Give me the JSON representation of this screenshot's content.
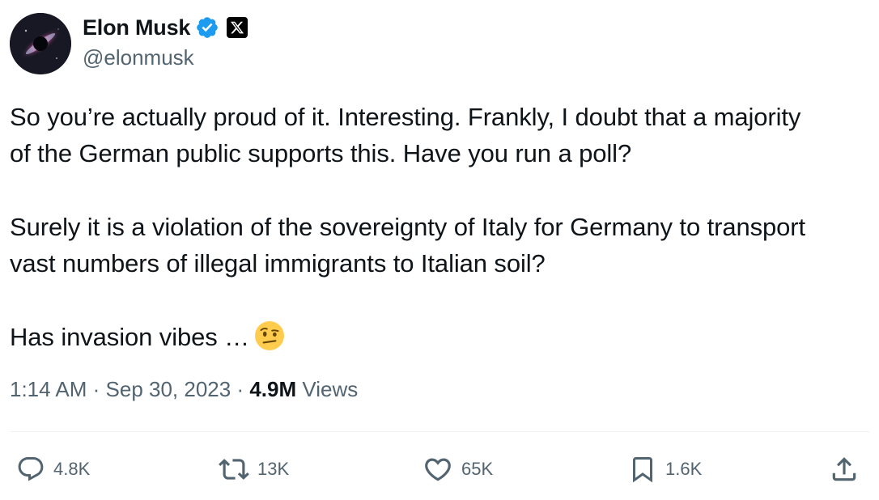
{
  "author": {
    "display_name": "Elon Musk",
    "handle": "@elonmusk",
    "verified_icon": "verified-badge-icon",
    "affiliation_icon": "x-logo-icon"
  },
  "tweet": {
    "paragraphs": [
      "So you’re actually proud of it. Interesting. Frankly, I doubt that a majority\nof the German public supports this. Have you run a poll?",
      "Surely it is a violation of the sovereignty of Italy for Germany to transport\nvast numbers of illegal immigrants to Italian soil?",
      "Has invasion vibes …"
    ],
    "emoji": "face-with-raised-eyebrow"
  },
  "meta": {
    "time": "1:14 AM",
    "separator": " · ",
    "date": "Sep 30, 2023",
    "views_count": "4.9M",
    "views_label": " Views"
  },
  "actions": {
    "reply_count": "4.8K",
    "repost_count": "13K",
    "like_count": "65K",
    "bookmark_count": "1.6K"
  },
  "colors": {
    "text_primary": "#0f1419",
    "text_secondary": "#536471",
    "verified_blue": "#1d9bf0",
    "divider": "#eff3f4"
  }
}
